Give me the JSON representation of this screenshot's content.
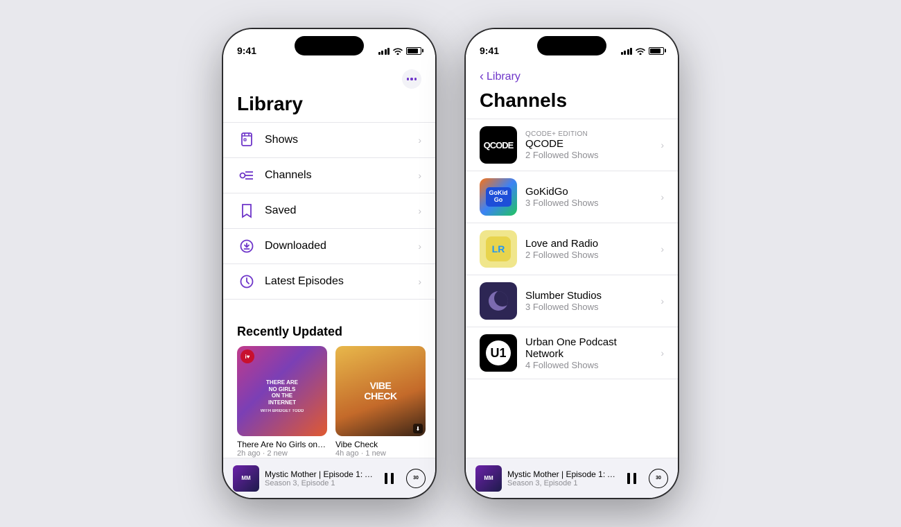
{
  "phone1": {
    "status": {
      "time": "9:41"
    },
    "header": {
      "title": "Library"
    },
    "menu": {
      "items": [
        {
          "id": "shows",
          "label": "Shows"
        },
        {
          "id": "channels",
          "label": "Channels"
        },
        {
          "id": "saved",
          "label": "Saved"
        },
        {
          "id": "downloaded",
          "label": "Downloaded"
        },
        {
          "id": "latest-episodes",
          "label": "Latest Episodes"
        }
      ]
    },
    "recently_updated": {
      "title": "Recently Updated",
      "items": [
        {
          "id": "no-girls",
          "name": "There Are No Girls on T...",
          "meta": "2h ago · 2 new"
        },
        {
          "id": "vibe-check",
          "name": "Vibe Check",
          "meta": "4h ago · 1 new"
        }
      ]
    },
    "mini_player": {
      "title": "Mystic Mother | Episode 1: A...",
      "subtitle": "Season 3, Episode 1"
    }
  },
  "phone2": {
    "status": {
      "time": "9:41"
    },
    "nav": {
      "back_label": "Library"
    },
    "header": {
      "title": "Channels"
    },
    "channels": [
      {
        "id": "qcode",
        "edition": "QCODE+ EDITION",
        "name": "QCODE",
        "meta": "2 Followed Shows"
      },
      {
        "id": "gokidgo",
        "edition": "",
        "name": "GoKidGo",
        "meta": "3 Followed Shows"
      },
      {
        "id": "love-radio",
        "edition": "",
        "name": "Love and Radio",
        "meta": "2 Followed Shows"
      },
      {
        "id": "slumber",
        "edition": "",
        "name": "Slumber Studios",
        "meta": "3 Followed Shows"
      },
      {
        "id": "urban",
        "edition": "",
        "name": "Urban One Podcast Network",
        "meta": "4 Followed Shows"
      }
    ],
    "mini_player": {
      "title": "Mystic Mother | Episode 1: A...",
      "subtitle": "Season 3, Episode 1"
    }
  }
}
